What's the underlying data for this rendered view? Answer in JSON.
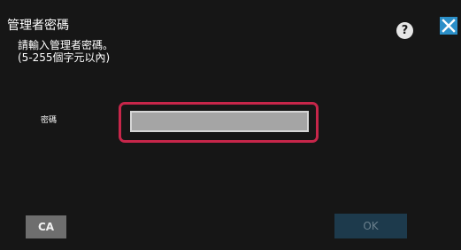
{
  "dialog": {
    "title": "管理者密碼",
    "instruction_line1": "請輸入管理者密碼。",
    "instruction_line2": "(5-255個字元以內)",
    "help_label": "?",
    "password_label": "密碼",
    "password_value": "",
    "clear_label": "CA",
    "ok_label": "OK"
  },
  "colors": {
    "background": "#161616",
    "highlight": "#c7264a",
    "close_button": "#2b8fc8",
    "ok_button_disabled": "#1d3a4c"
  },
  "icons": {
    "help": "question-circle-icon",
    "close": "close-icon"
  }
}
